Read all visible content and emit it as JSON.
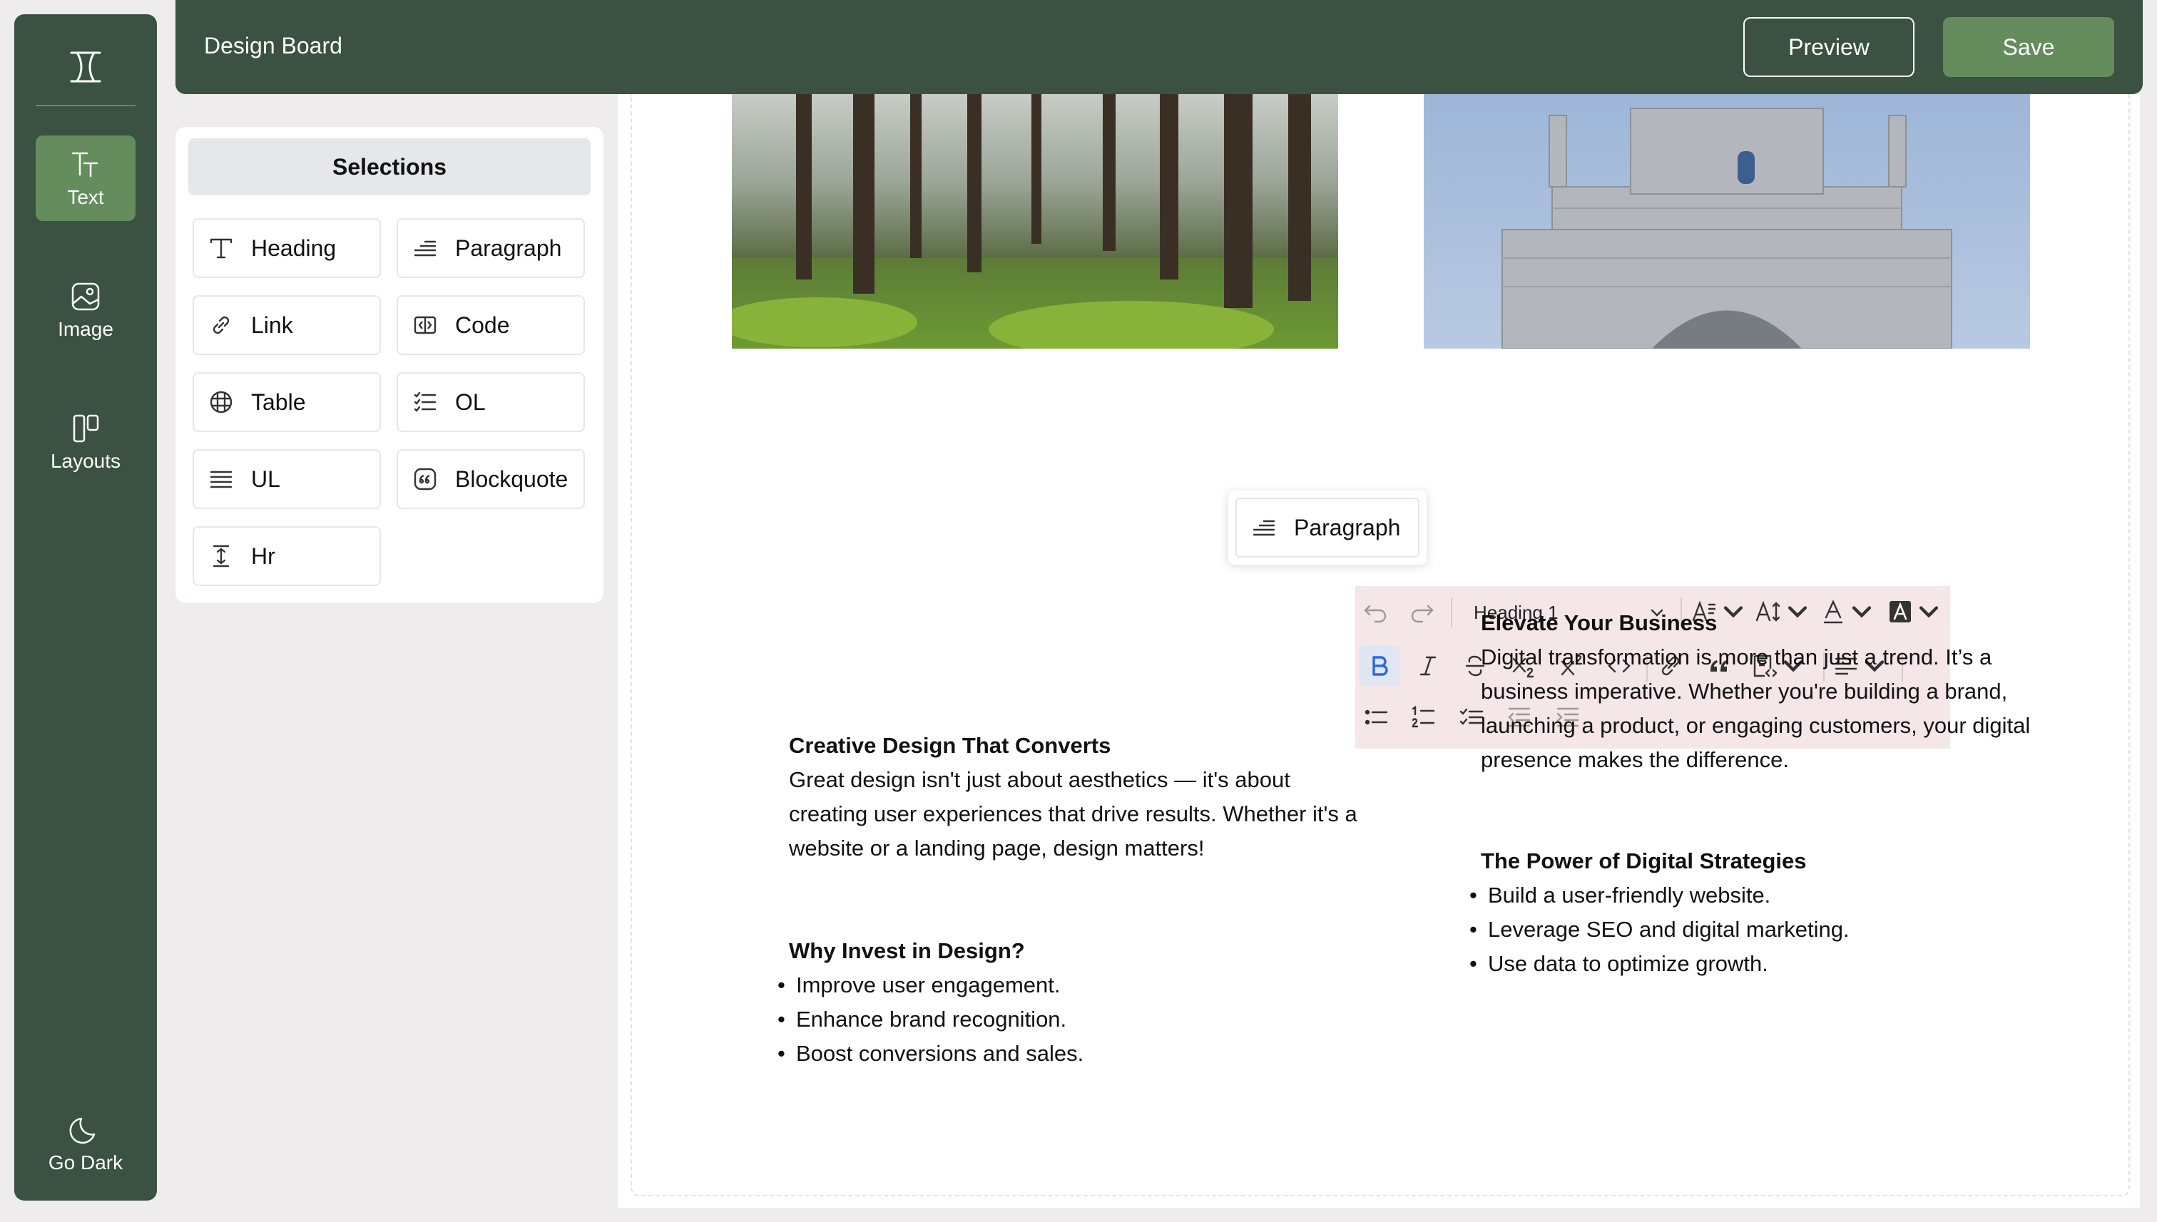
{
  "app": {
    "title": "Design Board"
  },
  "header": {
    "preview_label": "Preview",
    "save_label": "Save"
  },
  "rail": {
    "items": [
      {
        "label": "Text",
        "icon": "text-icon",
        "active": true
      },
      {
        "label": "Image",
        "icon": "image-icon"
      },
      {
        "label": "Layouts",
        "icon": "layouts-icon"
      }
    ],
    "bottom": {
      "label": "Go Dark",
      "icon": "moon-icon"
    }
  },
  "selections": {
    "title": "Selections",
    "items": [
      {
        "label": "Heading",
        "icon": "heading-icon"
      },
      {
        "label": "Paragraph",
        "icon": "paragraph-icon"
      },
      {
        "label": "Link",
        "icon": "link-icon"
      },
      {
        "label": "Code",
        "icon": "code-icon"
      },
      {
        "label": "Table",
        "icon": "table-icon"
      },
      {
        "label": "OL",
        "icon": "ordered-list-icon"
      },
      {
        "label": "UL",
        "icon": "unordered-list-icon"
      },
      {
        "label": "Blockquote",
        "icon": "blockquote-icon"
      },
      {
        "label": "Hr",
        "icon": "horizontal-rule-icon"
      }
    ]
  },
  "drag_chip": {
    "label": "Paragraph",
    "icon": "paragraph-icon"
  },
  "editor_toolbar": {
    "block_type": "Heading 1",
    "accent": "#2f6bd9",
    "background": "#f5e6e7"
  },
  "content": {
    "left": {
      "block1": {
        "heading": "Creative Design That Converts",
        "body": "Great design isn't just about aesthetics — it's about creating user experiences that drive results. Whether it's a website or a landing page, design matters!"
      },
      "block2": {
        "heading": "Why Invest in Design?",
        "items": [
          "Improve user engagement.",
          "Enhance brand recognition.",
          "Boost conversions and sales."
        ]
      }
    },
    "right": {
      "block1": {
        "heading": "Elevate Your Business",
        "body": "Digital transformation is more than just a trend. It’s a business imperative. Whether you're building a brand, launching a product, or engaging customers, your digital presence makes the difference."
      },
      "block2": {
        "heading": "The Power of Digital Strategies",
        "items": [
          "Build a user-friendly website.",
          "Leverage SEO and digital marketing.",
          "Use data to optimize growth."
        ]
      }
    }
  },
  "colors": {
    "primary": "#3b5142",
    "accent": "#648c5c",
    "canvas": "#ffffff"
  }
}
